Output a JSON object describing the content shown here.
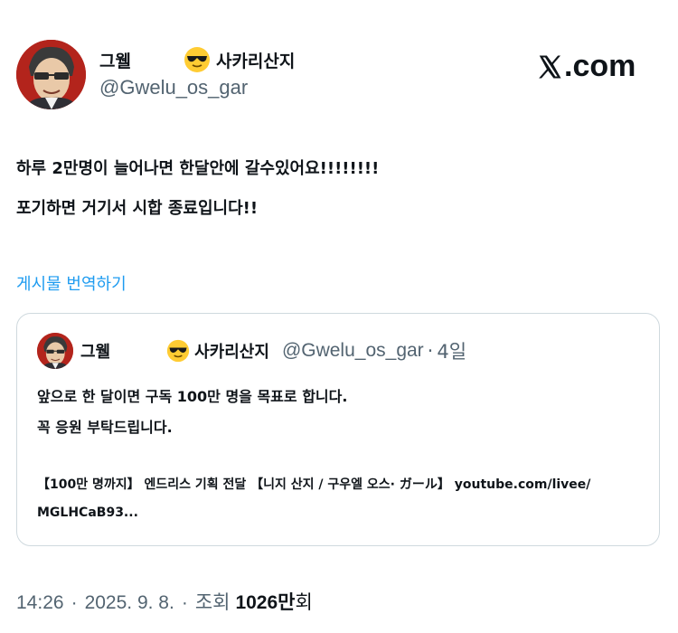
{
  "author": {
    "name": "그웰",
    "badge_text": "사카리산지",
    "handle": "@Gwelu_os_gar",
    "avatar_icon": "character-avatar",
    "badge_icon": "sunglasses-emoji"
  },
  "brand": {
    "text": ".com",
    "icon": "x-logo"
  },
  "post": {
    "lines": [
      "하루 2만명이 늘어나면 한달안에 갈수있어요!!!!!!!!",
      "포기하면 거기서 시합 종료입니다!!"
    ],
    "translate_label": "게시물 번역하기"
  },
  "quoted": {
    "name": "그웰",
    "badge_text": "사카리산지",
    "handle": "@Gwelu_os_gar",
    "separator": "·",
    "time": "4일",
    "lines": [
      "앞으로 한 달이면 구독 100만 명을 목표로 합니다.",
      "꼭 응원 부탁드립니다."
    ],
    "link_lines": [
      "【100만 명까지】 엔드리스 기획 전달 【니지 산지 / 구우엘 오스· ガール】 youtube.com/livee/",
      "MGLHCaB93..."
    ]
  },
  "meta": {
    "time": "14:26",
    "separator": "·",
    "date": "2025. 9. 8.",
    "views_label": "조회",
    "views_count": "1026만",
    "views_suffix": "회"
  }
}
